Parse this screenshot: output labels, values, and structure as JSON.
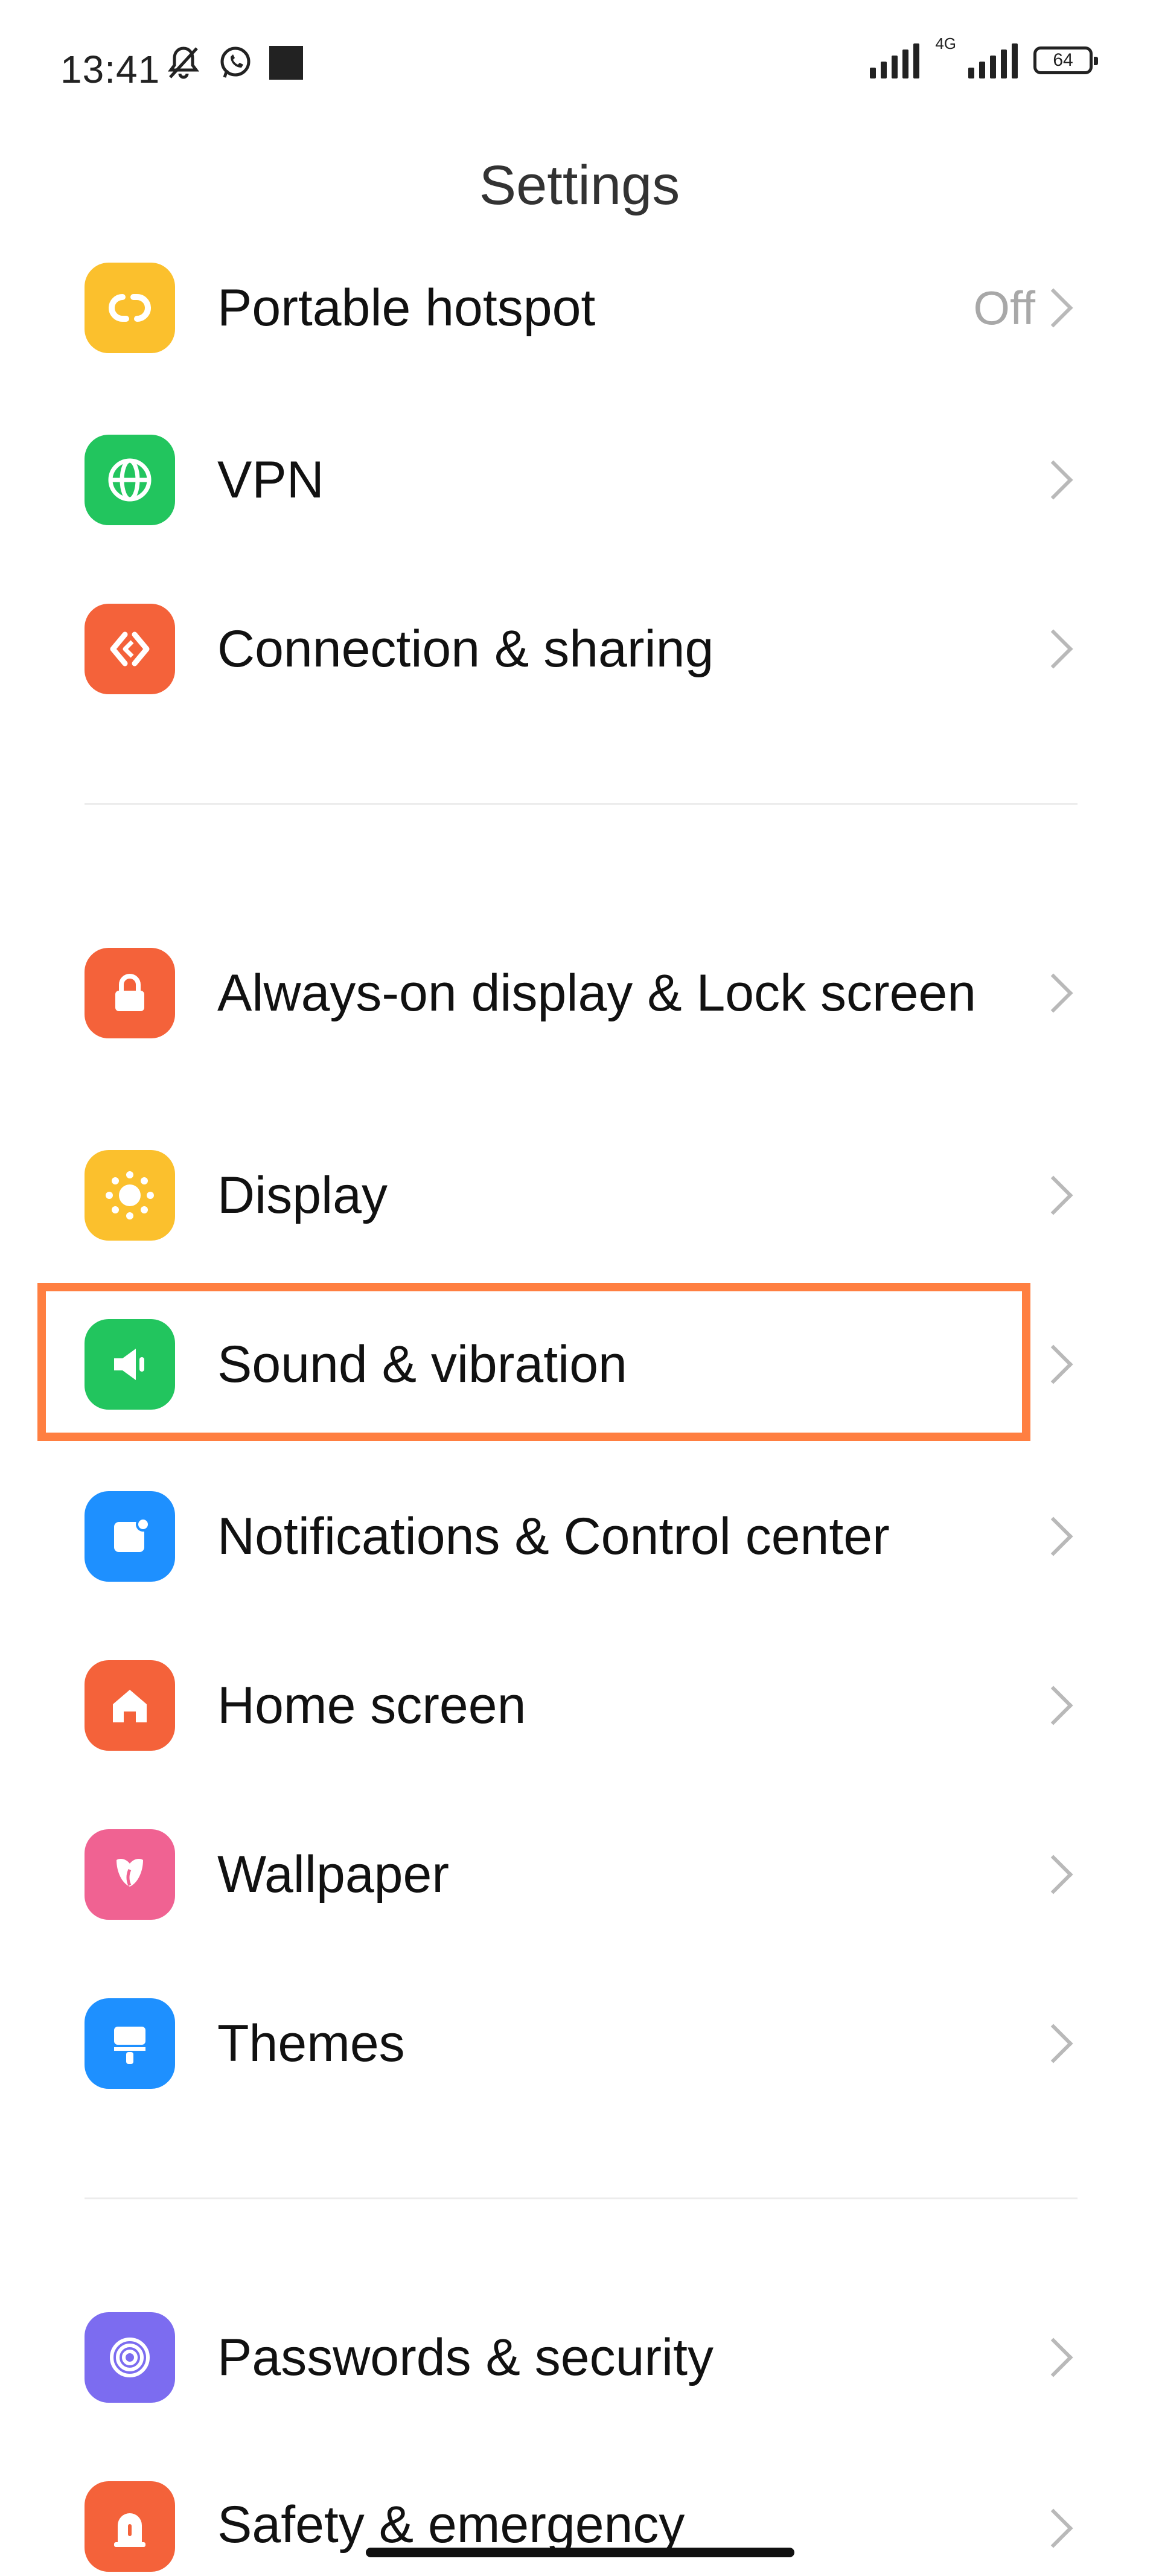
{
  "status_bar": {
    "time": "13:41",
    "network_type": "4G",
    "battery": "64",
    "icons": [
      "dnd-bell-off-icon",
      "whatsapp-icon",
      "app-notification-square-icon"
    ]
  },
  "header": {
    "title": "Settings"
  },
  "items": [
    {
      "id": "portable-hotspot",
      "label": "Portable hotspot",
      "value": "Off",
      "icon": "hotspot-icon",
      "color": "#FBC02D"
    },
    {
      "id": "vpn",
      "label": "VPN",
      "icon": "globe-icon",
      "color": "#22C55E"
    },
    {
      "id": "connection-sharing",
      "label": "Connection & sharing",
      "icon": "share-icon",
      "color": "#F4623A"
    },
    {
      "id": "always-on-display",
      "label": "Always-on display & Lock screen",
      "icon": "lock-icon",
      "color": "#F4623A"
    },
    {
      "id": "display",
      "label": "Display",
      "icon": "sun-icon",
      "color": "#FBC02D"
    },
    {
      "id": "sound-vibration",
      "label": "Sound & vibration",
      "icon": "speaker-icon",
      "color": "#22C55E"
    },
    {
      "id": "notifications",
      "label": "Notifications & Control center",
      "icon": "notification-icon",
      "color": "#1E90FF"
    },
    {
      "id": "home-screen",
      "label": "Home screen",
      "icon": "home-icon",
      "color": "#F4623A"
    },
    {
      "id": "wallpaper",
      "label": "Wallpaper",
      "icon": "flower-icon",
      "color": "#F06292"
    },
    {
      "id": "themes",
      "label": "Themes",
      "icon": "brush-icon",
      "color": "#1E90FF"
    },
    {
      "id": "passwords-security",
      "label": "Passwords & security",
      "icon": "fingerprint-icon",
      "color": "#7C6CF0"
    },
    {
      "id": "safety-emergency",
      "label": "Safety & emergency",
      "icon": "emergency-icon",
      "color": "#F4623A"
    }
  ],
  "highlight": {
    "target": "sound-vibration",
    "color": "#FF7F41"
  }
}
